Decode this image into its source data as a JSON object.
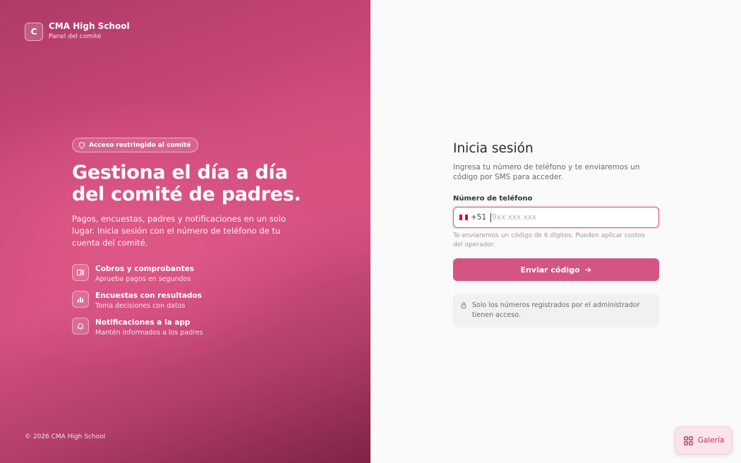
{
  "brand": {
    "logo_letter": "C",
    "name": "CMA High School",
    "subtitle": "Panel del comité"
  },
  "hero": {
    "badge": "Acceso restringido al comité",
    "headline": "Gestiona el día a día del comité de padres.",
    "description": "Pagos, encuestas, padres y notificaciones en un solo lugar. Inicia sesión con el número de teléfono de tu cuenta del comité.",
    "features": [
      {
        "icon": "receipt-icon",
        "title": "Cobros y comprobantes",
        "subtitle": "Aprueba pagos en segundos"
      },
      {
        "icon": "bar-chart-icon",
        "title": "Encuestas con resultados",
        "subtitle": "Toma decisiones con datos"
      },
      {
        "icon": "bell-icon",
        "title": "Notificaciones a la app",
        "subtitle": "Mantén informados a los padres"
      }
    ]
  },
  "footer": {
    "copyright": "© 2026 CMA High School"
  },
  "login": {
    "title": "Inicia sesión",
    "subtitle": "Ingresa tu número de teléfono y te enviaremos un código por SMS para acceder.",
    "phone_label": "Número de teléfono",
    "country_flag": "peru-flag",
    "country_code": "+51",
    "phone_value": "",
    "phone_placeholder": "9xx xxx xxx",
    "hint": "Te enviaremos un código de 6 dígitos. Pueden aplicar costos del operador.",
    "submit_label": "Enviar código",
    "note": "Solo los números registrados por el administrador tienen acceso."
  },
  "gallery_button": {
    "label": "Galería",
    "icon": "grid-icon"
  },
  "colors": {
    "accent": "#d35583",
    "panel_gradient_start": "#b03a66",
    "panel_gradient_end": "#7e2348"
  }
}
